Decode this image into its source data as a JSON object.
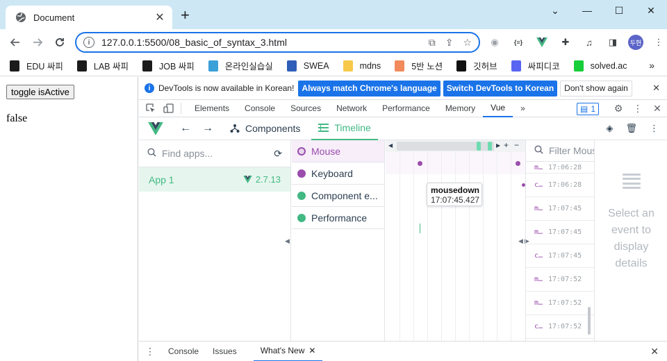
{
  "window": {
    "tab_title": "Document",
    "tab_close": "✕",
    "new_tab": "+",
    "controls": [
      "⌄",
      "—",
      "☐",
      "✕"
    ]
  },
  "toolbar": {
    "url": "127.0.0.1:5500/08_basic_of_syntax_3.html",
    "avatar_text": "두현"
  },
  "bookmarks": [
    {
      "label": "EDU 싸피",
      "icon": "ssafy-icon",
      "color": "#1b1b1b"
    },
    {
      "label": "LAB 싸피",
      "icon": "ssafy-icon",
      "color": "#1b1b1b"
    },
    {
      "label": "JOB 싸피",
      "icon": "ssafy-icon",
      "color": "#1b1b1b"
    },
    {
      "label": "온라인실습실",
      "icon": "ssafy-online-icon",
      "color": "#3aa0d8"
    },
    {
      "label": "SWEA",
      "icon": "swea-icon",
      "color": "#2f5eb8"
    },
    {
      "label": "mdns",
      "icon": "folder-icon",
      "color": "#f6c94b"
    },
    {
      "label": "5반 노션",
      "icon": "peach-icon",
      "color": "#f28a5b"
    },
    {
      "label": "깃허브",
      "icon": "github-icon",
      "color": "#111111"
    },
    {
      "label": "싸피디코",
      "icon": "discord-icon",
      "color": "#5865f2"
    },
    {
      "label": "solved.ac",
      "icon": "solvedac-icon",
      "color": "#17ce3a"
    }
  ],
  "bookmarks_more": "»",
  "page": {
    "button_label": "toggle isActive",
    "value_text": "false"
  },
  "devtools": {
    "infobar": {
      "message": "DevTools is now available in Korean!",
      "btn_match": "Always match Chrome's language",
      "btn_switch": "Switch DevTools to Korean",
      "btn_dismiss": "Don't show again"
    },
    "tabs": [
      "Elements",
      "Console",
      "Sources",
      "Network",
      "Performance",
      "Memory",
      "Vue"
    ],
    "active_tab": "Vue",
    "more_tabs": "»",
    "message_count": "1",
    "vue": {
      "tab_components": "Components",
      "tab_timeline": "Timeline",
      "find_apps_placeholder": "Find apps...",
      "app_name": "App 1",
      "app_version": "2.7.13",
      "layers": [
        {
          "label": "Mouse",
          "color": "#9b4dad",
          "selected": true
        },
        {
          "label": "Keyboard",
          "color": "#9b4dad",
          "selected": false
        },
        {
          "label": "Component e...",
          "color": "#42b883",
          "selected": false
        },
        {
          "label": "Performance",
          "color": "#42b883",
          "selected": false
        }
      ],
      "timeline_plus": "+",
      "timeline_minus": "−",
      "tooltip_title": "mousedown",
      "tooltip_time": "17:07:45.427",
      "filter_placeholder": "Filter Mouse",
      "events": [
        {
          "name": "m…",
          "time": "17:06:28"
        },
        {
          "name": "c…",
          "time": "17:06:28"
        },
        {
          "name": "m…",
          "time": "17:07:45"
        },
        {
          "name": "m…",
          "time": "17:07:45"
        },
        {
          "name": "c…",
          "time": "17:07:45"
        },
        {
          "name": "m…",
          "time": "17:07:52"
        },
        {
          "name": "m…",
          "time": "17:07:52"
        },
        {
          "name": "c…",
          "time": "17:07:52"
        }
      ],
      "details_placeholder": "Select an event to display details"
    },
    "drawer": {
      "tabs": [
        "Console",
        "Issues",
        "What's New"
      ],
      "active": "What's New",
      "close": "✕"
    }
  },
  "colors": {
    "vue_green": "#42b883",
    "mouse_purple": "#9b4dad",
    "chrome_blue": "#1a73e8",
    "titlebar": "#cde8f4"
  }
}
